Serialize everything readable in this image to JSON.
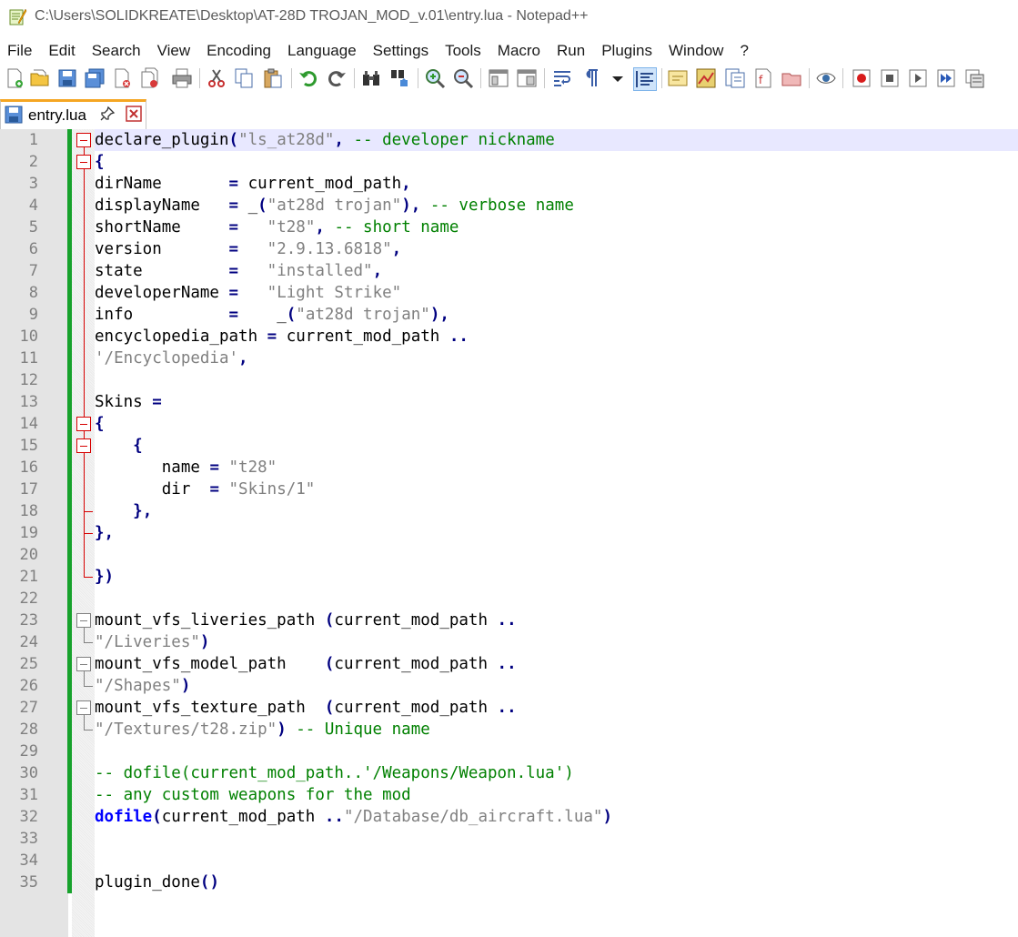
{
  "window": {
    "title": "C:\\Users\\SOLIDKREATE\\Desktop\\AT-28D TROJAN_MOD_v.01\\entry.lua - Notepad++"
  },
  "menu": [
    "File",
    "Edit",
    "Search",
    "View",
    "Encoding",
    "Language",
    "Settings",
    "Tools",
    "Macro",
    "Run",
    "Plugins",
    "Window",
    "?"
  ],
  "toolbar": {
    "icons": [
      "new-file-icon",
      "open-file-icon",
      "save-icon",
      "save-all-icon",
      "close-icon",
      "close-all-icon",
      "print-icon",
      "cut-icon",
      "copy-icon",
      "paste-icon",
      "undo-icon",
      "redo-icon",
      "find-icon",
      "replace-icon",
      "zoom-in-icon",
      "zoom-out-icon",
      "sync-vertical-icon",
      "sync-horizontal-icon",
      "word-wrap-icon",
      "show-all-characters-icon",
      "dropdown-arrow-icon",
      "indent-guide-icon",
      "user-defined-language-icon",
      "document-map-icon",
      "function-list-icon",
      "folder-as-workspace-icon",
      "monitoring-icon",
      "eye-icon",
      "record-macro-icon",
      "stop-recording-icon",
      "playback-icon",
      "run-macro-multiple-icon",
      "save-macro-icon"
    ]
  },
  "tab": {
    "label": "entry.lua"
  },
  "colors": {
    "change_bar": "#17a22c",
    "fold_marker": "#d60000",
    "current_line": "#e8e8ff",
    "tab_accent": "#f5a623"
  },
  "editor": {
    "lines": [
      {
        "n": "1",
        "tokens": [
          [
            "id",
            "declare_plugin"
          ],
          [
            "op",
            "("
          ],
          [
            "str",
            "\"ls_at28d\""
          ],
          [
            "op",
            ", "
          ],
          [
            "cmt",
            "-- developer nickname"
          ]
        ]
      },
      {
        "n": "2",
        "tokens": [
          [
            "op",
            "{"
          ]
        ]
      },
      {
        "n": "3",
        "tokens": [
          [
            "id",
            "dirName       "
          ],
          [
            "op",
            "= "
          ],
          [
            "id",
            "current_mod_path"
          ],
          [
            "op",
            ","
          ]
        ]
      },
      {
        "n": "4",
        "tokens": [
          [
            "id",
            "displayName   "
          ],
          [
            "op",
            "= "
          ],
          [
            "id",
            "_"
          ],
          [
            "op",
            "("
          ],
          [
            "str",
            "\"at28d trojan\""
          ],
          [
            "op",
            "), "
          ],
          [
            "cmt",
            "-- verbose name"
          ]
        ]
      },
      {
        "n": "5",
        "tokens": [
          [
            "id",
            "shortName     "
          ],
          [
            "op",
            "=   "
          ],
          [
            "str",
            "\"t28\""
          ],
          [
            "op",
            ", "
          ],
          [
            "cmt",
            "-- short name"
          ]
        ]
      },
      {
        "n": "6",
        "tokens": [
          [
            "id",
            "version       "
          ],
          [
            "op",
            "=   "
          ],
          [
            "str",
            "\"2.9.13.6818\""
          ],
          [
            "op",
            ","
          ]
        ]
      },
      {
        "n": "7",
        "tokens": [
          [
            "id",
            "state         "
          ],
          [
            "op",
            "=   "
          ],
          [
            "str",
            "\"installed\""
          ],
          [
            "op",
            ","
          ]
        ]
      },
      {
        "n": "8",
        "tokens": [
          [
            "id",
            "developerName "
          ],
          [
            "op",
            "=   "
          ],
          [
            "str",
            "\"Light Strike\""
          ]
        ]
      },
      {
        "n": "9",
        "tokens": [
          [
            "id",
            "info          "
          ],
          [
            "op",
            "=    "
          ],
          [
            "id",
            "_"
          ],
          [
            "op",
            "("
          ],
          [
            "str",
            "\"at28d trojan\""
          ],
          [
            "op",
            "),"
          ]
        ]
      },
      {
        "n": "10",
        "tokens": [
          [
            "id",
            "encyclopedia_path "
          ],
          [
            "op",
            "= "
          ],
          [
            "id",
            "current_mod_path "
          ],
          [
            "op",
            ".."
          ]
        ]
      },
      {
        "n": "11",
        "tokens": [
          [
            "str",
            "'/Encyclopedia'"
          ],
          [
            "op",
            ","
          ]
        ]
      },
      {
        "n": "12",
        "tokens": []
      },
      {
        "n": "13",
        "tokens": [
          [
            "id",
            "Skins "
          ],
          [
            "op",
            "="
          ]
        ]
      },
      {
        "n": "14",
        "tokens": [
          [
            "op",
            "{"
          ]
        ]
      },
      {
        "n": "15",
        "tokens": [
          [
            "id",
            "    "
          ],
          [
            "op",
            "{"
          ]
        ]
      },
      {
        "n": "16",
        "tokens": [
          [
            "id",
            "       name "
          ],
          [
            "op",
            "= "
          ],
          [
            "str",
            "\"t28\""
          ]
        ]
      },
      {
        "n": "17",
        "tokens": [
          [
            "id",
            "       dir  "
          ],
          [
            "op",
            "= "
          ],
          [
            "str",
            "\"Skins/1\""
          ]
        ]
      },
      {
        "n": "18",
        "tokens": [
          [
            "id",
            "    "
          ],
          [
            "op",
            "},"
          ]
        ]
      },
      {
        "n": "19",
        "tokens": [
          [
            "op",
            "},"
          ]
        ]
      },
      {
        "n": "20",
        "tokens": []
      },
      {
        "n": "21",
        "tokens": [
          [
            "op",
            "})"
          ]
        ]
      },
      {
        "n": "22",
        "tokens": []
      },
      {
        "n": "23",
        "tokens": [
          [
            "id",
            "mount_vfs_liveries_path "
          ],
          [
            "op",
            "("
          ],
          [
            "id",
            "current_mod_path "
          ],
          [
            "op",
            ".."
          ]
        ]
      },
      {
        "n": "24",
        "tokens": [
          [
            "str",
            "\"/Liveries\""
          ],
          [
            "op",
            ")"
          ]
        ]
      },
      {
        "n": "25",
        "tokens": [
          [
            "id",
            "mount_vfs_model_path    "
          ],
          [
            "op",
            "("
          ],
          [
            "id",
            "current_mod_path "
          ],
          [
            "op",
            ".."
          ]
        ]
      },
      {
        "n": "26",
        "tokens": [
          [
            "str",
            "\"/Shapes\""
          ],
          [
            "op",
            ")"
          ]
        ]
      },
      {
        "n": "27",
        "tokens": [
          [
            "id",
            "mount_vfs_texture_path  "
          ],
          [
            "op",
            "("
          ],
          [
            "id",
            "current_mod_path "
          ],
          [
            "op",
            ".."
          ]
        ]
      },
      {
        "n": "28",
        "tokens": [
          [
            "str",
            "\"/Textures/t28.zip\""
          ],
          [
            "op",
            ") "
          ],
          [
            "cmt",
            "-- Unique name"
          ]
        ]
      },
      {
        "n": "29",
        "tokens": []
      },
      {
        "n": "30",
        "tokens": [
          [
            "cmt",
            "-- dofile(current_mod_path..'/Weapons/Weapon.lua')"
          ]
        ]
      },
      {
        "n": "31",
        "tokens": [
          [
            "cmt",
            "-- any custom weapons for the mod"
          ]
        ]
      },
      {
        "n": "32",
        "tokens": [
          [
            "kw",
            "dofile"
          ],
          [
            "op",
            "("
          ],
          [
            "id",
            "current_mod_path "
          ],
          [
            "op",
            ".."
          ],
          [
            "str",
            "\"/Database/db_aircraft.lua\""
          ],
          [
            "op",
            ")"
          ]
        ]
      },
      {
        "n": "33",
        "tokens": []
      },
      {
        "n": "34",
        "tokens": []
      },
      {
        "n": "35",
        "tokens": [
          [
            "id",
            "plugin_done"
          ],
          [
            "op",
            "()"
          ]
        ]
      }
    ]
  }
}
